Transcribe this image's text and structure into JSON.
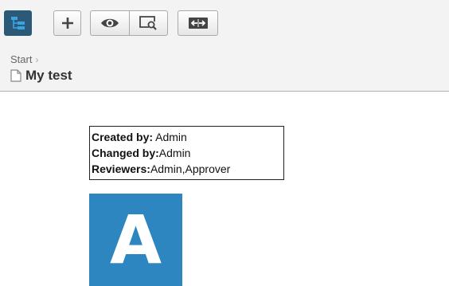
{
  "toolbar": {
    "buttons": [
      {
        "name": "tree-view",
        "icon": "tree-icon",
        "active": true
      },
      {
        "name": "add",
        "icon": "plus-icon"
      },
      {
        "name": "view",
        "icon": "eye-icon"
      },
      {
        "name": "preview",
        "icon": "preview-search-icon"
      },
      {
        "name": "compare",
        "icon": "compare-arrows-icon"
      }
    ],
    "active_color": "#2b5a78"
  },
  "breadcrumb": {
    "start_label": "Start"
  },
  "page": {
    "title": "My test",
    "icon": "page-icon"
  },
  "meta": {
    "created_by_label": "Created by:",
    "created_by_value": " Admin",
    "changed_by_label": "Changed by:",
    "changed_by_value": "Admin",
    "reviewers_label": "Reviewers:",
    "reviewers_value": "Admin,Approver"
  },
  "avatar": {
    "letter": "A",
    "color": "#2e86c1"
  }
}
